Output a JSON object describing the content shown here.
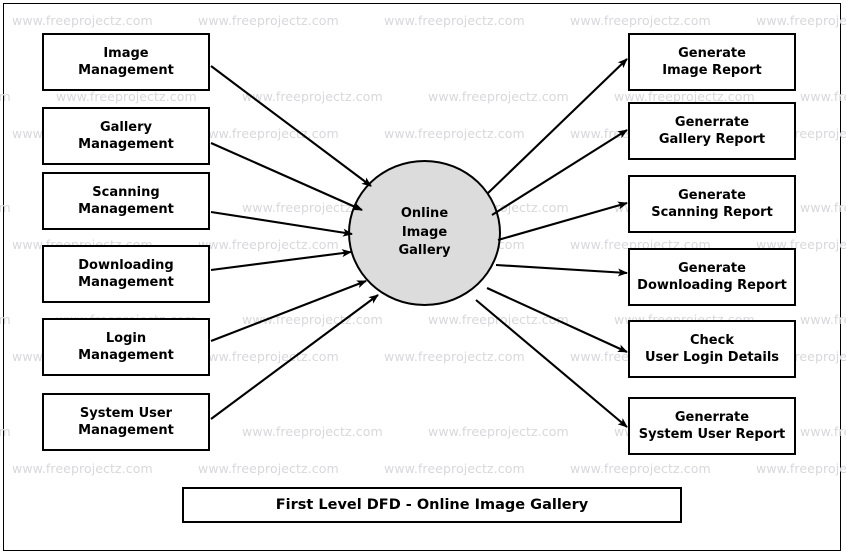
{
  "diagram": {
    "title": "First Level DFD - Online Image Gallery",
    "process": {
      "name": "Online\nImage\nGallery"
    },
    "watermark": {
      "text": "www.freeprojectz.com",
      "color": "#d8d8dc"
    },
    "colors": {
      "process_fill": "#dcdcdc",
      "box_fill": "#ffffff",
      "stroke": "#000000",
      "background": "#ffffff"
    },
    "inputs": [
      {
        "label": "Image\nManagement"
      },
      {
        "label": "Gallery\nManagement"
      },
      {
        "label": "Scanning\nManagement"
      },
      {
        "label": "Downloading\nManagement"
      },
      {
        "label": "Login\nManagement"
      },
      {
        "label": "System User\nManagement"
      }
    ],
    "outputs": [
      {
        "label": "Generate\nImage Report"
      },
      {
        "label": "Generrate\nGallery Report"
      },
      {
        "label": "Generate\nScanning Report"
      },
      {
        "label": "Generate\nDownloading Report"
      },
      {
        "label": "Check\nUser Login Details"
      },
      {
        "label": "Generrate\nSystem User Report"
      }
    ]
  }
}
